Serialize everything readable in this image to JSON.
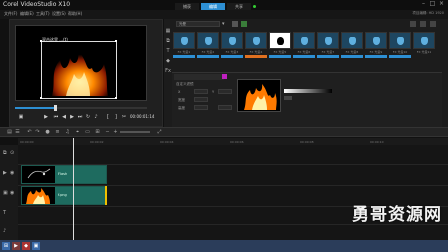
{
  "app": {
    "title": "Corel VideoStudio X10"
  },
  "window_controls": {
    "minimize": "–",
    "maximize": "□",
    "close": "×"
  },
  "menu": [
    "文件(F)",
    "编辑(E)",
    "工具(T)",
    "设置(S)",
    "帮助(H)"
  ],
  "stage_tabs": [
    "捕获",
    "编辑",
    "共享"
  ],
  "project_info": "项目编辑: HD 1920",
  "preview": {
    "title_text": "双击这里 ...(t)",
    "timecode": "00:00:01:14"
  },
  "library": {
    "dropdown": "光晕",
    "thumbnails": [
      {
        "label": "FX 光晕1",
        "selected": false
      },
      {
        "label": "FX 光晕2",
        "selected": false
      },
      {
        "label": "FX 光晕3",
        "selected": false
      },
      {
        "label": "FX 光晕4",
        "selected": false
      },
      {
        "label": "FX 光晕5",
        "selected": true
      },
      {
        "label": "FX 光晕6",
        "selected": false
      },
      {
        "label": "FX 光晕7",
        "selected": false
      },
      {
        "label": "FX 光晕8",
        "selected": false
      },
      {
        "label": "FX 光晕9",
        "selected": false
      },
      {
        "label": "FX 光晕10",
        "selected": false
      },
      {
        "label": "FX 光晕11",
        "selected": false
      }
    ],
    "color_bars": [
      "#2d8fd3",
      "#2d8fd3",
      "#2d8fd3",
      "#e07020",
      "#2d8fd3",
      "#2d8fd3",
      "#2d8fd3",
      "#2d8fd3",
      "#2d8fd3",
      "#2d8fd3"
    ]
  },
  "properties": {
    "section_label": "自定义滤镜",
    "labels": [
      "X",
      "Y",
      "宽度",
      "高度"
    ],
    "accent": "#c020c0"
  },
  "timeline": {
    "ticks": [
      "00:00:00",
      "00:00:02",
      "00:00:04",
      "00:00:06",
      "00:00:08",
      "00:00:10"
    ],
    "tracks": [
      {
        "name": "视频",
        "clip_label": "Flash"
      },
      {
        "name": "覆叠",
        "clip_label": "f.png"
      }
    ]
  },
  "watermark": "勇哥资源网",
  "colors": {
    "accent": "#2d8fd3",
    "clip": "#1e6b5f",
    "taskbar": "#2b3d5a"
  }
}
